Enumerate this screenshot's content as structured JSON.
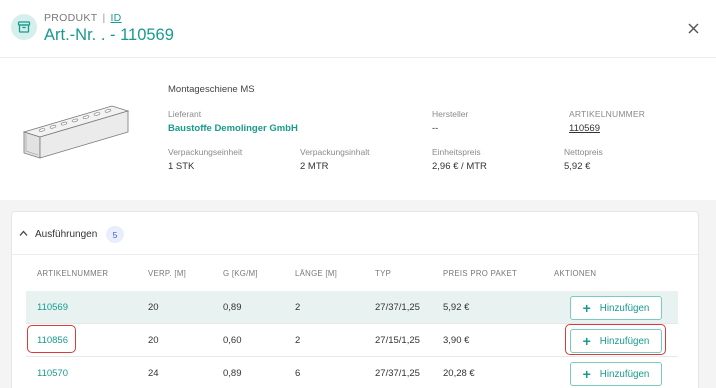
{
  "header": {
    "kicker": "PRODUKT",
    "separator": "|",
    "id_link": "ID",
    "title": "Art.-Nr. . - 110569"
  },
  "product": {
    "name": "Montageschiene MS",
    "lieferant_label": "Lieferant",
    "lieferant_value": "Baustoffe Demolinger GmbH",
    "hersteller_label": "Hersteller",
    "hersteller_value": "--",
    "artikelnummer_label": "ARTIKELNUMMER",
    "artikelnummer_value": "110569",
    "vpe_label": "Verpackungseinheit",
    "vpe_value": "1 STK",
    "vpi_label": "Verpackungsinhalt",
    "vpi_value": "2 MTR",
    "einheitspreis_label": "Einheitspreis",
    "einheitspreis_value": "2,96 € / MTR",
    "nettopreis_label": "Nettopreis",
    "nettopreis_value": "5,92 €"
  },
  "section": {
    "title": "Ausführungen",
    "count": "5"
  },
  "table": {
    "headers": [
      "ARTIKELNUMMER",
      "VERP. [M]",
      "G [KG/M]",
      "LÄNGE [M]",
      "TYP",
      "PREIS PRO PAKET",
      "AKTIONEN"
    ],
    "rows": [
      [
        "110569",
        "20",
        "0,89",
        "2",
        "27/37/1,25",
        "5,92 €"
      ],
      [
        "110856",
        "20",
        "0,60",
        "2",
        "27/15/1,25",
        "3,90 €"
      ],
      [
        "110570",
        "24",
        "0,89",
        "6",
        "27/37/1,25",
        "20,28 €"
      ]
    ],
    "action_label": "Hinzufügen"
  },
  "icons": {
    "header": "archive-box-icon",
    "close": "close-icon",
    "collapse": "chevron-up-icon",
    "add": "plus-icon"
  },
  "colors": {
    "accent": "#179b8d",
    "highlight_row": "#e8f3f1",
    "badge_bg": "#e8eefc",
    "badge_text": "#3b5bdb",
    "annotation": "#d93a3a"
  }
}
